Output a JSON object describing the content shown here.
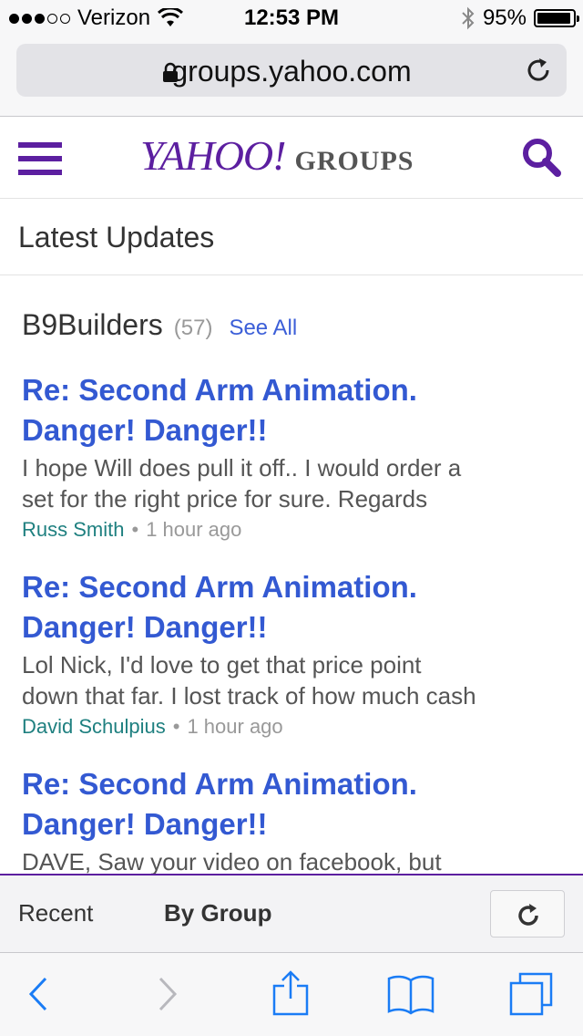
{
  "status_bar": {
    "carrier": "Verizon",
    "signal_bars_filled": 3,
    "signal_bars_total": 5,
    "time": "12:53 PM",
    "battery_percent": "95%",
    "battery_level": 0.95
  },
  "browser": {
    "url": "groups.yahoo.com"
  },
  "header": {
    "logo_main": "YAHOO!",
    "logo_sub": "GROUPS"
  },
  "section": {
    "title": "Latest Updates"
  },
  "group": {
    "name": "B9Builders",
    "count": "(57)",
    "see_all": "See All"
  },
  "posts": [
    {
      "title_line1": "Re: Second Arm Animation.",
      "title_line2": "Danger! Danger!!",
      "body_line1": "I hope Will does pull it off.. I would order a",
      "body_line2": "set for the right price for sure. Regards",
      "author": "Russ Smith",
      "time": "1 hour ago"
    },
    {
      "title_line1": "Re: Second Arm Animation.",
      "title_line2": "Danger! Danger!!",
      "body_line1": "Lol Nick, I'd love to get that price point",
      "body_line2": "down that far. I lost track of how much cash",
      "author": "David Schulpius",
      "time": "1 hour ago"
    },
    {
      "title_line1": "Re: Second Arm Animation.",
      "title_line2": "Danger! Danger!!",
      "body_line1": "DAVE, Saw your video on facebook, but"
    }
  ],
  "tabs": {
    "recent": "Recent",
    "by_group": "By Group"
  },
  "colors": {
    "yahoo_purple": "#5c1fa0",
    "link_blue": "#3359d2",
    "author_teal": "#1f8080",
    "ios_blue": "#1a7cf5"
  },
  "toolbar_icons": [
    "back-icon",
    "forward-icon",
    "share-icon",
    "bookmarks-icon",
    "tabs-icon"
  ]
}
